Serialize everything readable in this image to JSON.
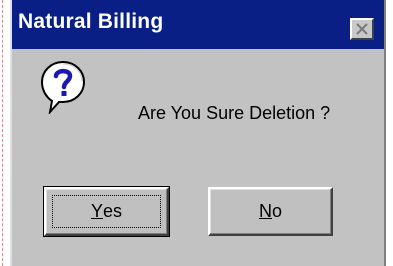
{
  "window": {
    "title": "Natural Billing",
    "close_icon": "close-icon"
  },
  "dialog": {
    "icon": "question-icon",
    "message": "Are You Sure Deletion ?",
    "buttons": {
      "yes": {
        "accel": "Y",
        "rest": "es"
      },
      "no": {
        "accel": "N",
        "rest": "o"
      }
    }
  },
  "colors": {
    "titlebar": "#0a1f86",
    "title_text": "#ffffff",
    "dialog_face": "#c0c0c0"
  }
}
